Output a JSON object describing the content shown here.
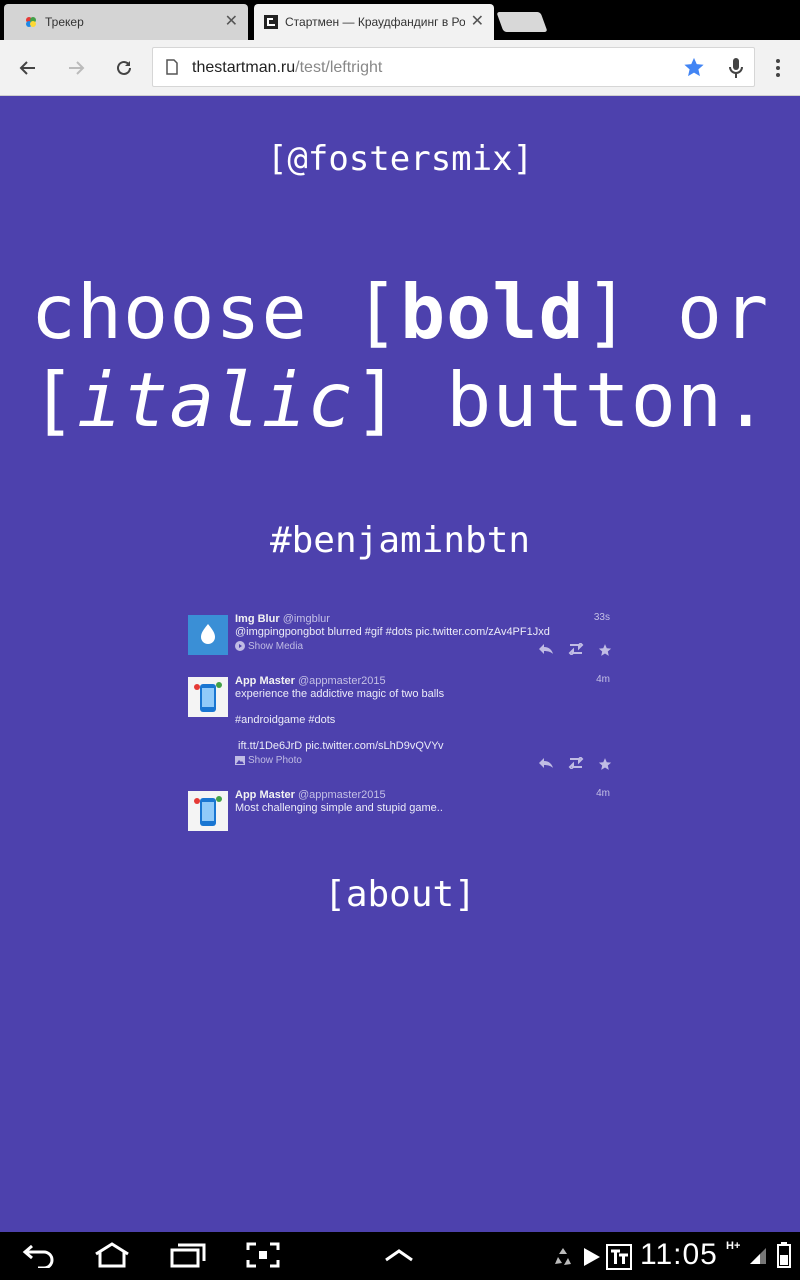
{
  "browser": {
    "tabs": [
      {
        "title": "Трекер",
        "active": false
      },
      {
        "title": "Стартмен — Краудфандинг в Ро",
        "active": true
      }
    ],
    "url": {
      "host": "thestartman.ru",
      "path": "/test/leftright"
    },
    "bookmarked": true
  },
  "page": {
    "handle": "[@fostersmix]",
    "headline": {
      "word_choose": "choose",
      "bracket_open": "[",
      "bold": "bold",
      "bracket_close_or": "] or",
      "italic": "italic",
      "bracket_close_button": "] button."
    },
    "hashtag": "#benjaminbtn",
    "about": "[about]",
    "background": "#4d41ad"
  },
  "tweets": [
    {
      "name": "Img Blur",
      "screen": "@imgblur",
      "time": "33s",
      "lines": [
        "@imgpingpongbot blurred #gif #dots pic.twitter.com/zAv4PF1Jxd"
      ],
      "media": "Show Media",
      "avatar": "droplet-avatar"
    },
    {
      "name": "App Master",
      "screen": "@appmaster2015",
      "time": "4m",
      "lines": [
        "experience the addictive magic of two balls",
        "",
        "#androidgame #dots",
        "",
        " ift.tt/1De6JrD pic.twitter.com/sLhD9vQVYv"
      ],
      "media": "Show Photo",
      "avatar": "phone-avatar"
    },
    {
      "name": "App Master",
      "screen": "@appmaster2015",
      "time": "4m",
      "lines": [
        "Most challenging simple and stupid game.."
      ],
      "media": "",
      "avatar": "phone-avatar"
    }
  ],
  "status": {
    "time": "11:05",
    "network": "H+"
  }
}
